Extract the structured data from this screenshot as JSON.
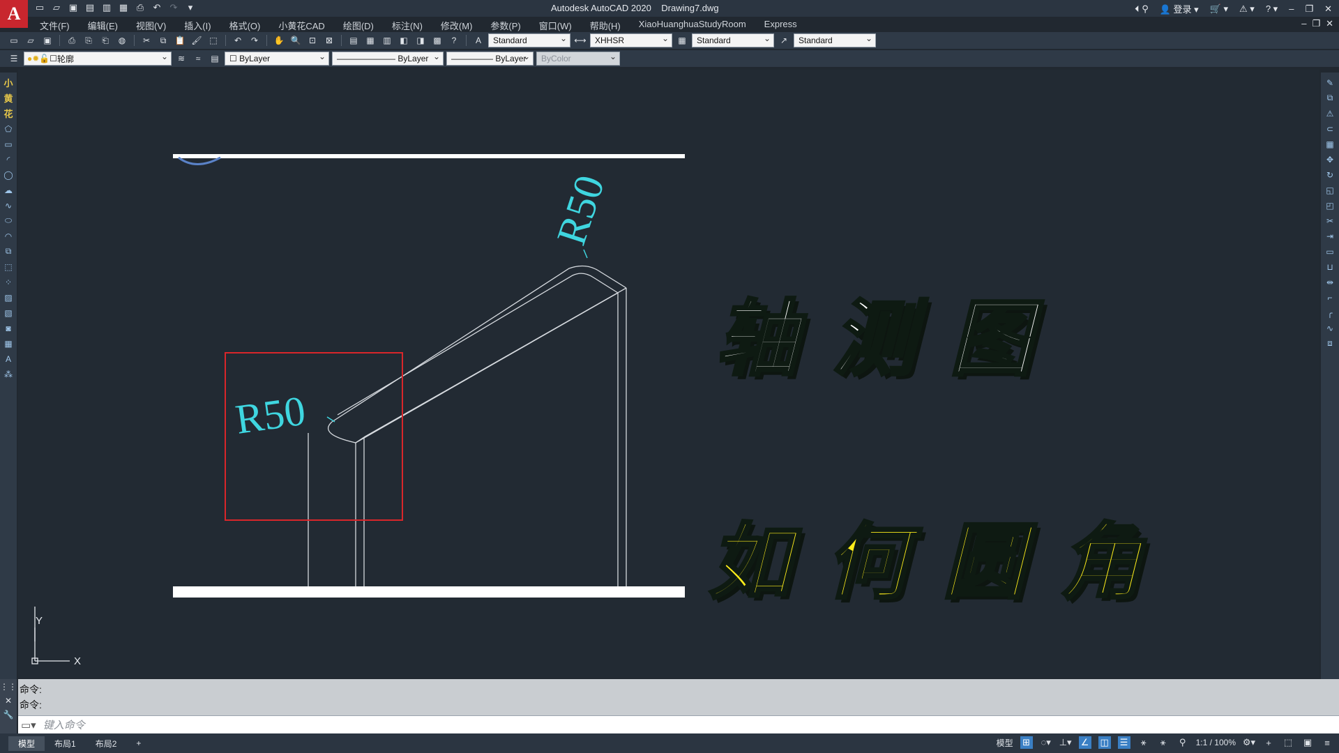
{
  "window": {
    "app_title": "Autodesk AutoCAD 2020",
    "file_name": "Drawing7.dwg",
    "login_label": "登录"
  },
  "menu": [
    "文件(F)",
    "编辑(E)",
    "视图(V)",
    "插入(I)",
    "格式(O)",
    "小黄花CAD",
    "绘图(D)",
    "标注(N)",
    "修改(M)",
    "参数(P)",
    "窗口(W)",
    "帮助(H)",
    "XiaoHuanghuaStudyRoom",
    "Express"
  ],
  "toolbar": {
    "text_style": "Standard",
    "dim_style": "XHHSR",
    "table_style": "Standard",
    "mleader_style": "Standard",
    "layer": "轮廓",
    "color": "ByLayer",
    "linetype": "ByLayer",
    "lineweight": "ByLayer",
    "plotstyle": "ByColor"
  },
  "left_tools_cn": [
    "小",
    "黄",
    "花"
  ],
  "drawing": {
    "dim_label_1": "R50",
    "dim_label_2": "R50",
    "ucs_y": "Y",
    "ucs_x": "X"
  },
  "headline": {
    "line1": "轴测图",
    "line2": "如何圆角"
  },
  "colors": {
    "headline1": "#ffffff",
    "headline2": "#ffee1a",
    "dim_text": "#3fd6e0",
    "highlight_box": "#d9262a"
  },
  "command": {
    "history": [
      "命令:",
      "命令:"
    ],
    "placeholder": "键入命令"
  },
  "status": {
    "tabs": [
      "模型",
      "布局1",
      "布局2"
    ],
    "add_tab": "+",
    "model_label": "模型",
    "scale": "1:1 / 100%"
  }
}
